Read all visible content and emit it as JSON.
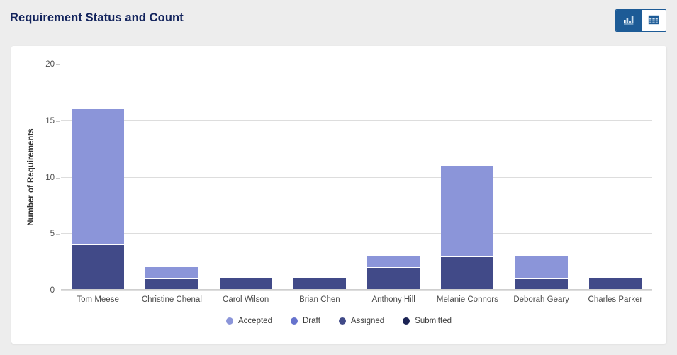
{
  "header": {
    "title": "Requirement Status and Count",
    "toggle": {
      "chart_button": {
        "icon": "bar-chart-icon",
        "active": true
      },
      "table_button": {
        "icon": "table-grid-icon",
        "active": false
      }
    }
  },
  "theme": {
    "page_bg": "#ededed",
    "card_bg": "#ffffff",
    "title_color": "#12235c",
    "toggle_accent": "#1d5b96"
  },
  "chart_data": {
    "type": "bar",
    "stacked": true,
    "title": "Requirement Status and Count",
    "xlabel": "",
    "ylabel": "Number of Requirements",
    "ylim": [
      0,
      20
    ],
    "yticks": [
      0,
      5,
      10,
      15,
      20
    ],
    "grid": true,
    "legend_position": "bottom",
    "categories": [
      "Tom Meese",
      "Christine Chenal",
      "Carol Wilson",
      "Brian Chen",
      "Anthony Hill",
      "Melanie Connors",
      "Deborah Geary",
      "Charles Parker"
    ],
    "series": [
      {
        "name": "Submitted",
        "color": "#1b2354",
        "values": [
          0,
          0,
          0,
          0,
          0,
          0,
          0,
          0
        ]
      },
      {
        "name": "Assigned",
        "color": "#414a88",
        "values": [
          4,
          1,
          1,
          1,
          2,
          3,
          1,
          1
        ]
      },
      {
        "name": "Draft",
        "color": "#6673cd",
        "values": [
          0,
          0,
          0,
          0,
          0,
          0,
          0,
          0
        ]
      },
      {
        "name": "Accepted",
        "color": "#8b95d9",
        "values": [
          12,
          1,
          0,
          0,
          1,
          8,
          2,
          0
        ]
      }
    ],
    "totals": [
      16,
      2,
      1,
      1,
      3,
      11,
      3,
      1
    ],
    "legend": [
      {
        "label": "Accepted",
        "color": "#8b95d9"
      },
      {
        "label": "Draft",
        "color": "#6673cd"
      },
      {
        "label": "Assigned",
        "color": "#414a88"
      },
      {
        "label": "Submitted",
        "color": "#1b2354"
      }
    ]
  }
}
